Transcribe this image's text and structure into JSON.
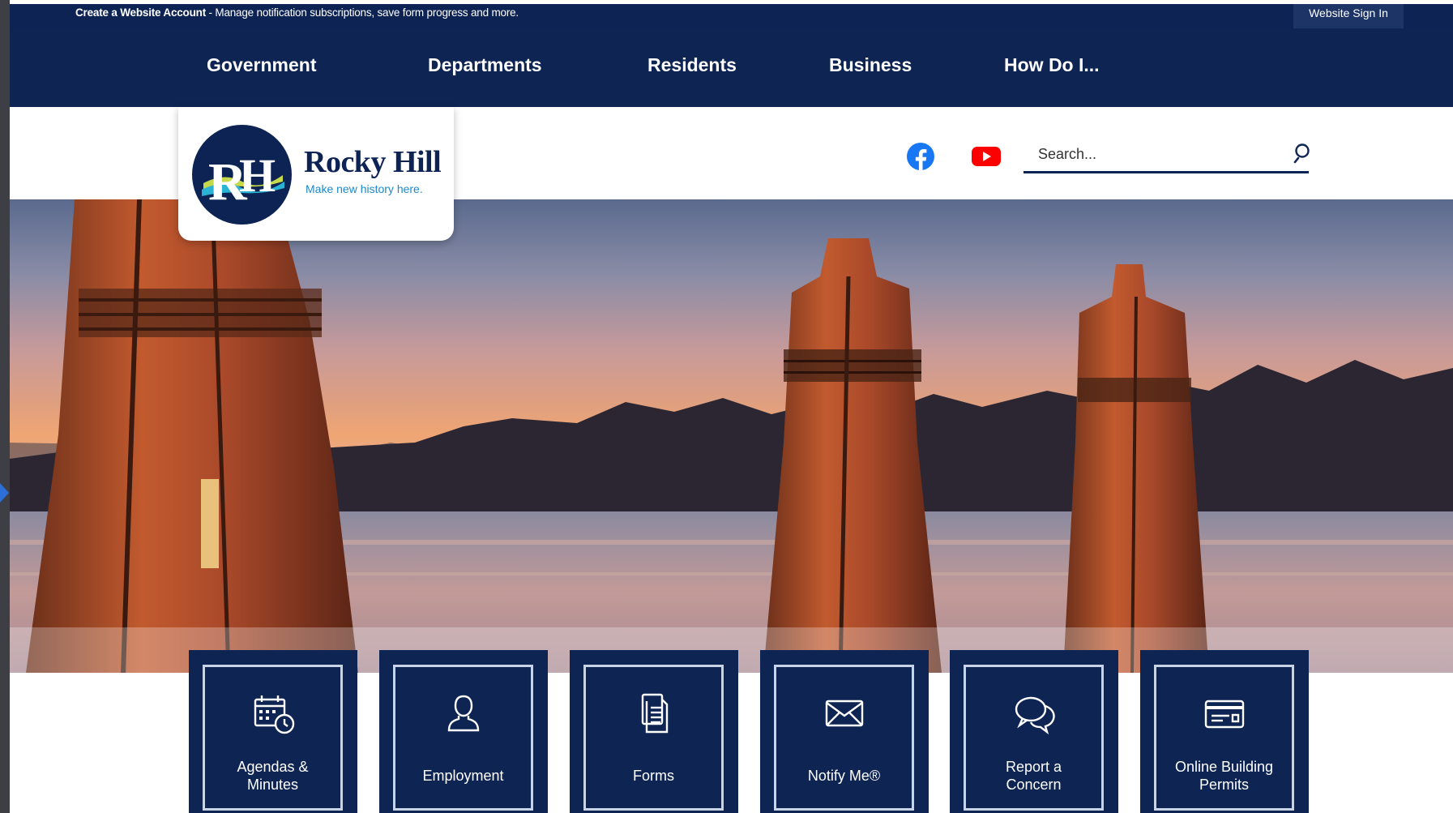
{
  "utility": {
    "create_account_link": "Create a Website Account",
    "create_account_desc": " - Manage notification subscriptions, save form progress and more.",
    "signin_label": "Website Sign In"
  },
  "nav": {
    "items": [
      {
        "label": "Government"
      },
      {
        "label": "Departments"
      },
      {
        "label": "Residents"
      },
      {
        "label": "Business"
      },
      {
        "label": "How Do I..."
      }
    ]
  },
  "logo": {
    "monogram": "RH",
    "name": "Rocky Hill",
    "tagline": "Make new history here."
  },
  "social": {
    "facebook_icon": "facebook-icon",
    "youtube_icon": "youtube-icon"
  },
  "search": {
    "placeholder": "Search...",
    "value": ""
  },
  "hero": {
    "image": "sunset-river-pilings-photo"
  },
  "quick_links": [
    {
      "label": "Agendas &\nMinutes",
      "icon": "calendar-clock-icon"
    },
    {
      "label": "Employment",
      "icon": "person-icon"
    },
    {
      "label": "Forms",
      "icon": "documents-icon"
    },
    {
      "label": "Notify Me®",
      "icon": "envelope-icon"
    },
    {
      "label": "Report a\nConcern",
      "icon": "speech-bubbles-icon"
    },
    {
      "label": "Online Building\nPermits",
      "icon": "card-icon"
    }
  ],
  "colors": {
    "navy": "#0e2452",
    "accent_blue": "#1b8ac9",
    "facebook": "#1877f2",
    "youtube": "#ff0000"
  }
}
